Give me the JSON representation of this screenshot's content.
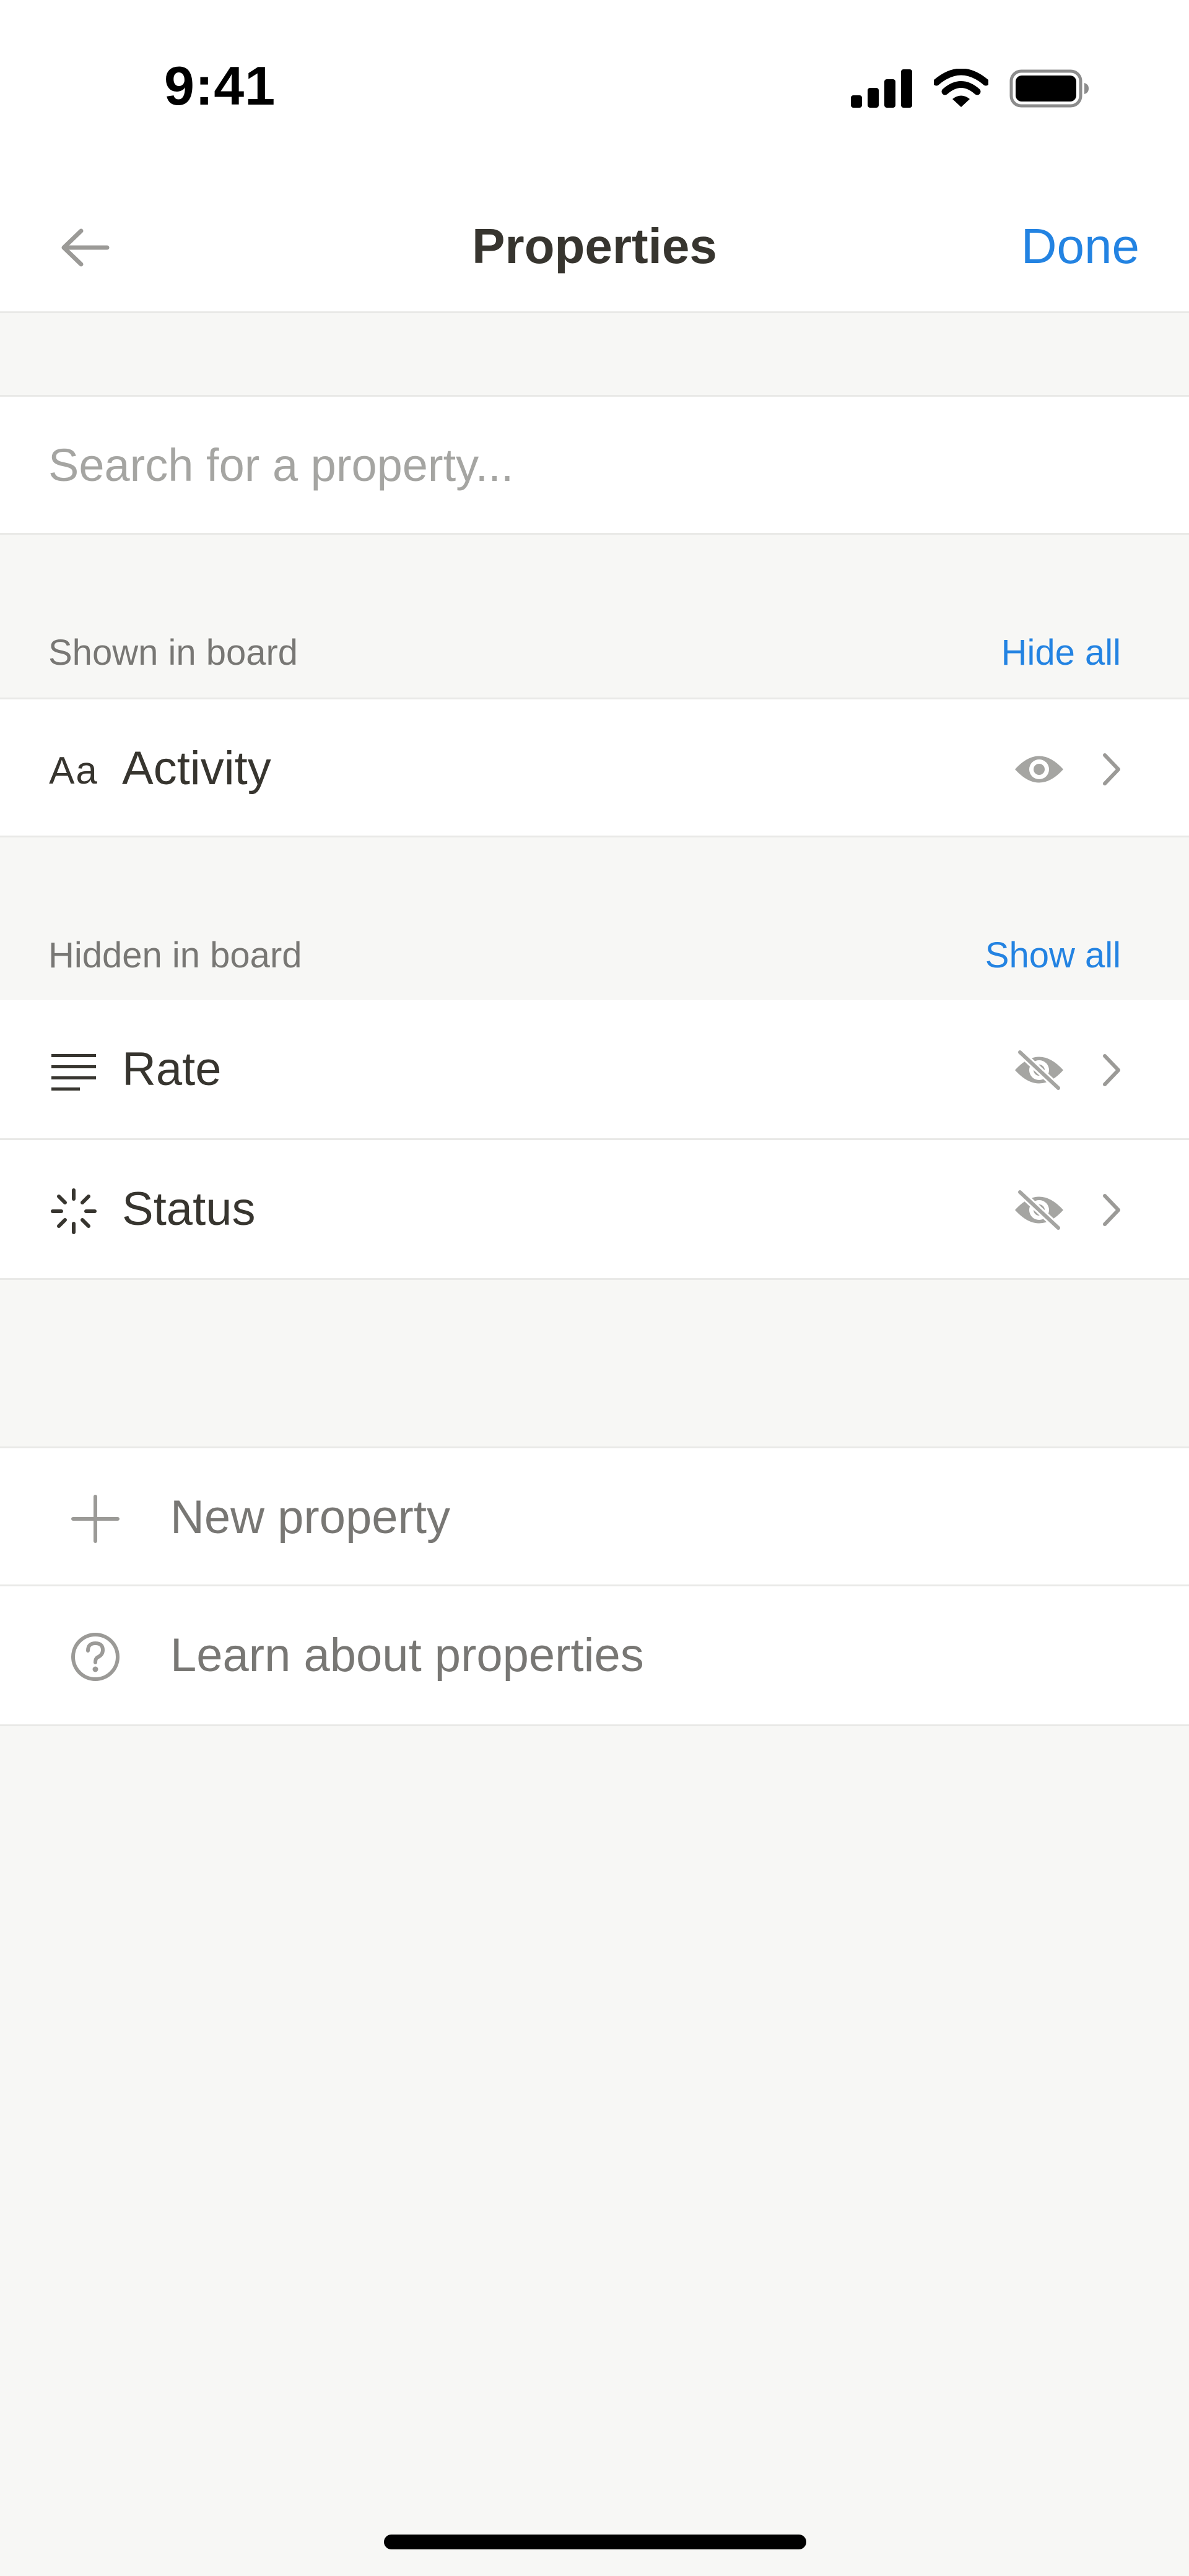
{
  "status_bar": {
    "time": "9:41"
  },
  "nav": {
    "title": "Properties",
    "done_label": "Done"
  },
  "search": {
    "placeholder": "Search for a property..."
  },
  "shown_section": {
    "label": "Shown in board",
    "action": "Hide all",
    "items": [
      {
        "label": "Activity",
        "icon_text": "Aa",
        "icon": "text-type-icon",
        "visible": true
      }
    ]
  },
  "hidden_section": {
    "label": "Hidden in board",
    "action": "Show all",
    "items": [
      {
        "label": "Rate",
        "icon": "lines-icon",
        "visible": false
      },
      {
        "label": "Status",
        "icon": "status-spinner-icon",
        "visible": false
      }
    ]
  },
  "actions": [
    {
      "label": "New property",
      "icon": "plus-icon"
    },
    {
      "label": "Learn about properties",
      "icon": "question-circle-icon"
    }
  ],
  "colors": {
    "accent": "#2383e2",
    "text": "#37352f",
    "muted": "#787774",
    "background": "#f7f7f5"
  }
}
